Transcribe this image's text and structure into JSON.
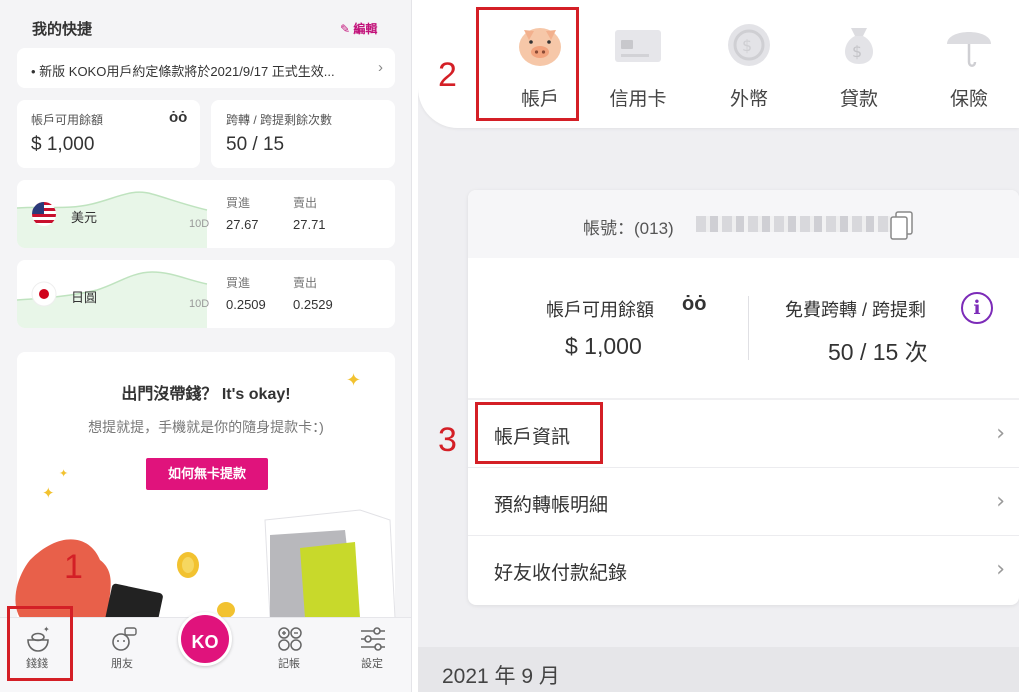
{
  "left": {
    "quick": {
      "title": "我的快捷",
      "edit_label": "編輯"
    },
    "notice": {
      "text": "• 新版 KOKO用戶約定條款將於2021/9/17 正式生效..."
    },
    "balance": {
      "label": "帳戶可用餘額",
      "value": "$ 1,000"
    },
    "transfer": {
      "label": "跨轉 / 跨提剩餘次數",
      "value": "50 / 15"
    },
    "fx": [
      {
        "name": "美元",
        "period": "10D",
        "buy_label": "買進",
        "buy": "27.67",
        "sell_label": "賣出",
        "sell": "27.71"
      },
      {
        "name": "日圓",
        "period": "10D",
        "buy_label": "買進",
        "buy": "0.2509",
        "sell_label": "賣出",
        "sell": "0.2529"
      }
    ],
    "promo": {
      "title": "出門沒帶錢？ It's okay!",
      "subtitle": "想提就提，手機就是你的隨身提款卡：)",
      "button": "如何無卡提款"
    },
    "bottom_nav": [
      {
        "label": "錢錢",
        "icon": "money-bowl-icon"
      },
      {
        "label": "朋友",
        "icon": "friend-chat-icon"
      },
      {
        "label": "KO",
        "icon": "ko-logo"
      },
      {
        "label": "記帳",
        "icon": "calculator-icon"
      },
      {
        "label": "設定",
        "icon": "settings-sliders-icon"
      }
    ],
    "step1": "1"
  },
  "right": {
    "tabs": [
      {
        "label": "帳戶",
        "icon": "pig-icon"
      },
      {
        "label": "信用卡",
        "icon": "credit-card-icon"
      },
      {
        "label": "外幣",
        "icon": "coin-icon"
      },
      {
        "label": "貸款",
        "icon": "money-bag-icon"
      },
      {
        "label": "保險",
        "icon": "umbrella-icon"
      }
    ],
    "step2": "2",
    "step3": "3",
    "account": {
      "number_label": "帳號：(013)",
      "balance_label": "帳戶可用餘額",
      "balance_value": "$ 1,000",
      "free_label": "免費跨轉 / 跨提剩",
      "free_value": "50 / 15 次"
    },
    "menu": [
      {
        "label": "帳戶資訊"
      },
      {
        "label": "預約轉帳明細"
      },
      {
        "label": "好友收付款紀錄"
      }
    ],
    "date_header": "2021 年 9 月"
  },
  "colors": {
    "accent": "#e0137c",
    "annotation_red": "#d41f26",
    "info_purple": "#7c2bb8"
  }
}
